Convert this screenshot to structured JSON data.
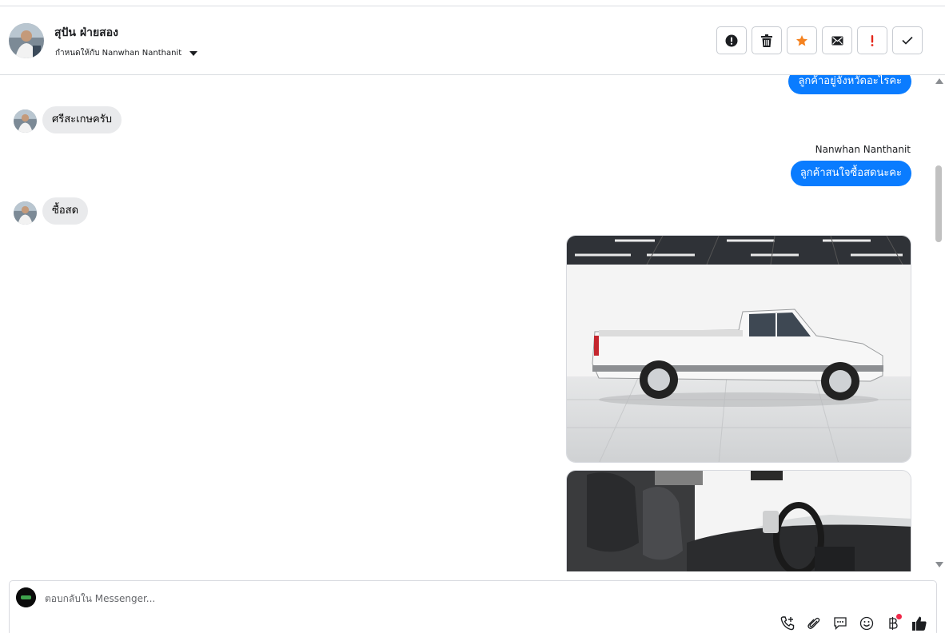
{
  "header": {
    "contact_name": "สุปัน ฝ่ายสอง",
    "assigned_to": "กำหนดให้กับ Nanwhan Nanthanit"
  },
  "toolbar": {
    "buttons": [
      "spam-alert-icon",
      "trash-icon",
      "star-icon",
      "envelope-icon",
      "exclamation-icon",
      "check-icon"
    ],
    "star_color": "#f5821f",
    "exclamation_color": "#e4271b"
  },
  "messages": {
    "out_1": "ลูกค้าอยู่จังหวัดอะไรคะ",
    "in_1": "ศรีสะเกษครับ",
    "sender_name": "Nanwhan Nanthanit",
    "out_2": "ลูกค้าสนใจซื้อสดนะคะ",
    "in_2": "ซื้อสด",
    "photo_1": "white-pickup-truck-side-view",
    "photo_2": "pickup-truck-interior-view"
  },
  "composer": {
    "placeholder": "ตอบกลับใน Messenger...",
    "tools": [
      "call-add-icon",
      "paperclip-icon",
      "chat-bubble-icon",
      "emoji-icon",
      "baht-icon",
      "thumbs-up-icon"
    ]
  },
  "colors": {
    "accent": "#0a7cff",
    "incoming_bubble": "#e9eaec",
    "notification_dot": "#f02849"
  }
}
